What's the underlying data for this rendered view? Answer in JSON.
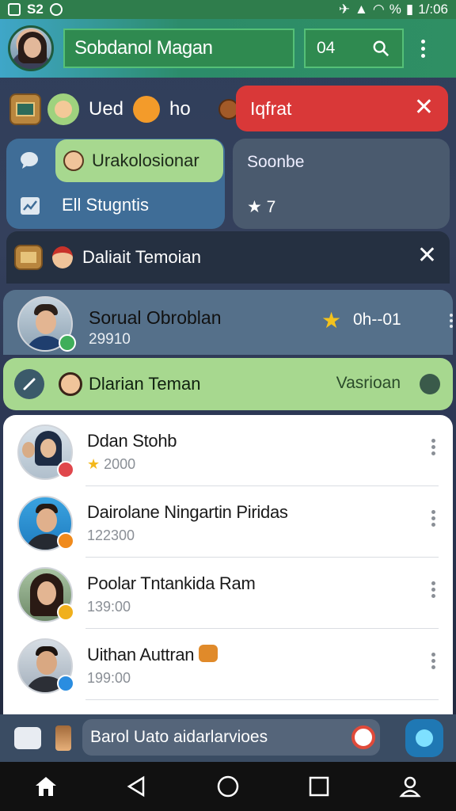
{
  "statusbar": {
    "left_text": "S2",
    "time": "1/:06",
    "battery_text": "%"
  },
  "header": {
    "title": "Sobdanol Magan",
    "code": "04"
  },
  "quick_row": {
    "label_a": "Ued",
    "label_b": "ho"
  },
  "alert": {
    "label": "Iqfrat"
  },
  "left_card": {
    "top_label": "Urakolosionar",
    "bottom_label": "Ell Stugntis"
  },
  "right_card": {
    "title": "Soonbe",
    "star_count": "7"
  },
  "banner": {
    "label": "Daliait Temoian"
  },
  "featured": {
    "name": "Sorual Obroblan",
    "number": "29910",
    "code": "0h--01"
  },
  "greenbar": {
    "label": "Dlarian Teman",
    "right_label": "Vasrioan"
  },
  "contacts": [
    {
      "name": "Ddan Stohb",
      "sub": "2000",
      "badge_color": "#e0474c"
    },
    {
      "name": "Dairolane Ningartin Piridas",
      "sub": "122300",
      "badge_color": "#f08a1c"
    },
    {
      "name": "Poolar Tntankida Ram",
      "sub": "139:00",
      "badge_color": "#f0b01c"
    },
    {
      "name": "Uithan Auttran",
      "sub": "199:00",
      "badge_color": "#2a8de0"
    }
  ],
  "inputbar": {
    "text": "Barol Uato aidarlarvioes"
  },
  "icons": {
    "search": "search-icon",
    "more": "more-vert-icon",
    "close": "close-icon",
    "home": "home-icon",
    "back": "back-icon",
    "recents": "recents-icon",
    "profile": "profile-icon"
  }
}
